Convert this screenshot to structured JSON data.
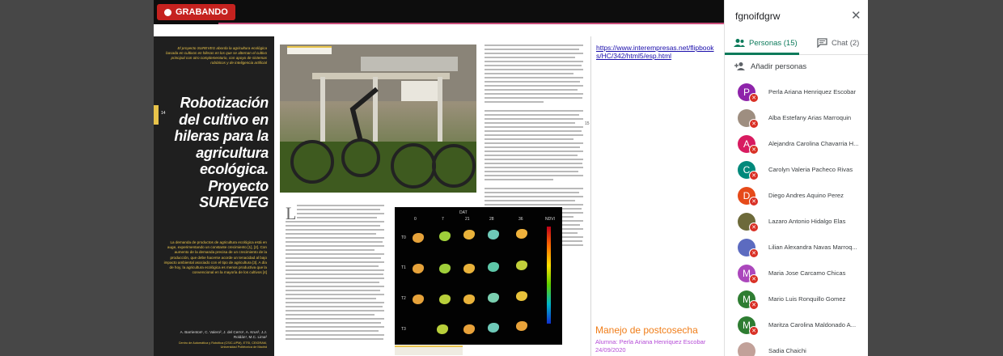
{
  "meeting": {
    "recording_label": "GRABANDO",
    "accent_recording": "#c5221f"
  },
  "magazine": {
    "intro": "El proyecto SUREVEG aborda la agricultura ecológica basada en cultivos en hileras en los que se alternan el cultivo principal con otro complementario, con apoyo de sistemas robóticos y de inteligencia artificial",
    "title": "Robotización del cultivo en hileras para la agricultura ecológica. Proyecto SUREVEG",
    "abstract": "La demanda de productos de agricultura ecológica está en auge, experimentando un constante crecimiento [1], [2]. Con aumento de la demanda precisa de un crecimiento de la producción, que debe hacerse acorde un tenacidad al bajo impacto ambiental asociado con el tipo de agricultura [3]. A día de hoy, la agricultura ecológica es menos productiva que la convencional en la mayoría de los cultivos [4]",
    "authors": "A. Barrientos¹, C. Valero², J. del Cerro¹, A. Krus³, J.J. Roldán¹, M.C. Lima²",
    "affiliation": "Centro de Automática y Robótica (CSIC-UPM), ETSI, CEIGRAM, Universidad Politécnica de Madrid",
    "page_left": "14",
    "page_right": "15",
    "chart_header": "DAT",
    "day_labels": [
      "0",
      "7",
      "21",
      "28",
      "36"
    ],
    "row_labels": [
      "T0",
      "T1",
      "T2",
      "T3"
    ],
    "colorbar_label": "NDVI"
  },
  "notes": {
    "link": "https://www.interempresas.net/flipbooks/HC/342/html5/esp.html",
    "title": "Manejo de postcosecha",
    "student": "Alumna: Perla Ariana Henriquez Escobar",
    "date": "24/09/2020"
  },
  "panel": {
    "meeting_code": "fgnoifdgrw",
    "tab_people": "Personas (15)",
    "tab_chat": "Chat (2)",
    "add_people": "Añadir personas",
    "accent": "#0b7a5a",
    "participants": [
      {
        "initial": "P",
        "name": "Perla Ariana Henriquez Escobar",
        "color": "#8e24aa"
      },
      {
        "initial": "",
        "name": "Alba Estefany Arias Marroquin",
        "color": "#9e8e80"
      },
      {
        "initial": "A",
        "name": "Alejandra Carolina Chavarria H...",
        "color": "#d81b60"
      },
      {
        "initial": "C",
        "name": "Carolyn Valeria Pacheco Rivas",
        "color": "#00897b"
      },
      {
        "initial": "D",
        "name": "Diego Andres Aquino Perez",
        "color": "#e64a19"
      },
      {
        "initial": "",
        "name": "Lazaro Antonio Hidalgo Elas",
        "color": "#6d6a3a"
      },
      {
        "initial": "",
        "name": "Lilian Alexandra Navas Marroq...",
        "color": "#5c6bc0"
      },
      {
        "initial": "M",
        "name": "Maria Jose Carcamo Chicas",
        "color": "#ab47bc"
      },
      {
        "initial": "M",
        "name": "Mario Luis Ronquillo Gomez",
        "color": "#2e7d32"
      },
      {
        "initial": "M",
        "name": "Maritza Carolina Maldonado A...",
        "color": "#2e7d32"
      },
      {
        "initial": "",
        "name": "Sadia Chaichi",
        "color": "#c2a199"
      }
    ]
  }
}
